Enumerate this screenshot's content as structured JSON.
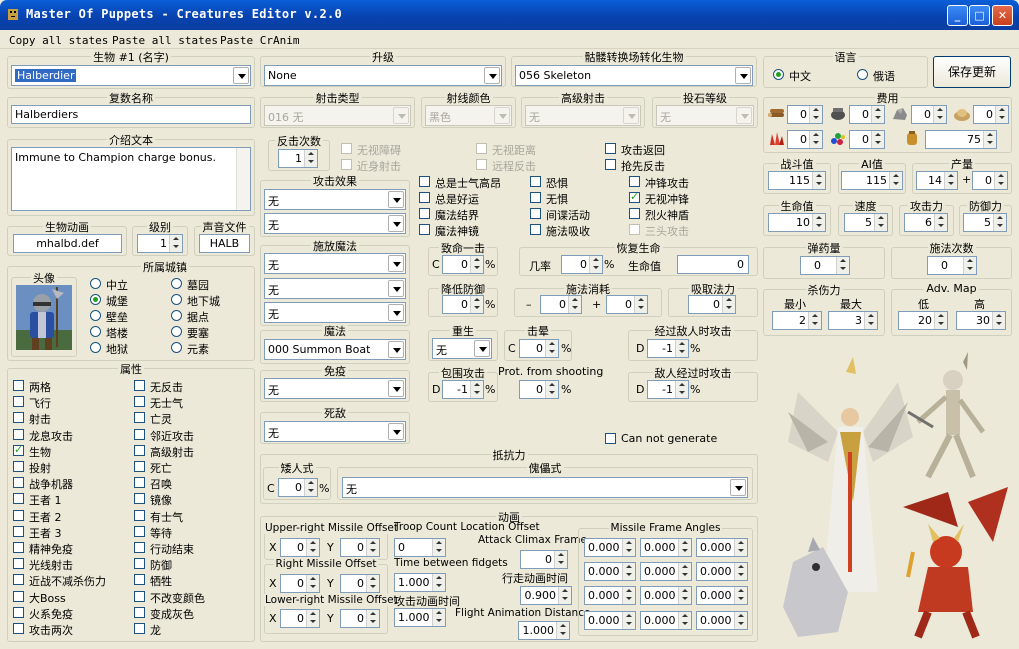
{
  "window": {
    "title": "Master Of Puppets - Creatures Editor v.2.0"
  },
  "menu": [
    "Copy all states",
    "Paste all states",
    "Paste CrAnim"
  ],
  "creature": {
    "name_label": "生物 #1 (名字)",
    "name_value": "Halberdier",
    "plural_label": "复数名称",
    "plural_value": "Halberdiers",
    "desc_label": "介绍文本",
    "desc_value": "Immune to Champion charge bonus.",
    "anim_label": "生物动画",
    "anim_value": "mhalbd.def",
    "level_label": "级别",
    "level_value": "1",
    "sound_label": "声音文件",
    "sound_value": "HALB"
  },
  "portrait": {
    "label": "头像"
  },
  "town": {
    "label": "所属城镇",
    "options": [
      "中立",
      "墓园",
      "城堡",
      "地下城",
      "壁垒",
      "据点",
      "塔楼",
      "要塞",
      "地狱",
      "元素"
    ],
    "selected": "城堡"
  },
  "attributes": {
    "label": "属性",
    "left": [
      {
        "label": "两格",
        "checked": false
      },
      {
        "label": "飞行",
        "checked": false
      },
      {
        "label": "射击",
        "checked": false
      },
      {
        "label": "龙息攻击",
        "checked": false
      },
      {
        "label": "生物",
        "checked": true
      },
      {
        "label": "投射",
        "checked": false
      },
      {
        "label": "战争机器",
        "checked": false
      },
      {
        "label": "王者 1",
        "checked": false
      },
      {
        "label": "王者 2",
        "checked": false
      },
      {
        "label": "王者 3",
        "checked": false
      },
      {
        "label": "精神免疫",
        "checked": false
      },
      {
        "label": "光线射击",
        "checked": false
      },
      {
        "label": "近战不减杀伤力",
        "checked": false
      },
      {
        "label": "大Boss",
        "checked": false
      },
      {
        "label": "火系免疫",
        "checked": false
      },
      {
        "label": "攻击两次",
        "checked": false
      }
    ],
    "right": [
      {
        "label": "无反击",
        "checked": false
      },
      {
        "label": "无士气",
        "checked": false
      },
      {
        "label": "亡灵",
        "checked": false
      },
      {
        "label": "邻近攻击",
        "checked": false
      },
      {
        "label": "高级射击",
        "checked": false
      },
      {
        "label": "死亡",
        "checked": false
      },
      {
        "label": "召唤",
        "checked": false
      },
      {
        "label": "镜像",
        "checked": false
      },
      {
        "label": "有士气",
        "checked": false
      },
      {
        "label": "等待",
        "checked": false
      },
      {
        "label": "行动结束",
        "checked": false
      },
      {
        "label": "防御",
        "checked": false
      },
      {
        "label": "牺牲",
        "checked": false
      },
      {
        "label": "不改变颜色",
        "checked": false
      },
      {
        "label": "变成灰色",
        "checked": false
      },
      {
        "label": "龙",
        "checked": false
      }
    ]
  },
  "upgrade": {
    "label": "升级",
    "value": "None"
  },
  "skeleton": {
    "label": "骷髅转换场转化生物",
    "value": "056 Skeleton"
  },
  "shoot_type": {
    "label": "射击类型",
    "value": "016 无"
  },
  "ray_color": {
    "label": "射线颜色",
    "value": "黑色"
  },
  "adv_shoot": {
    "label": "高级射击",
    "value": "无"
  },
  "stone_level": {
    "label": "投石等级",
    "value": "无"
  },
  "counter": {
    "label": "反击次数",
    "value": "1"
  },
  "mid_checks": [
    {
      "label": "无视障碍",
      "checked": false,
      "disabled": true
    },
    {
      "label": "近身射击",
      "checked": false,
      "disabled": true
    },
    {
      "label": "无视距离",
      "checked": false,
      "disabled": true
    },
    {
      "label": "远程反击",
      "checked": false,
      "disabled": true
    },
    {
      "label": "攻击返回",
      "checked": false,
      "disabled": false
    },
    {
      "label": "抢先反击",
      "checked": false,
      "disabled": false
    }
  ],
  "attack_effect": {
    "label": "攻击效果",
    "values": [
      "无",
      "无"
    ]
  },
  "effect_checks": [
    {
      "label": "总是士气高昂",
      "checked": false,
      "disabled": false
    },
    {
      "label": "恐惧",
      "checked": false,
      "disabled": false
    },
    {
      "label": "冲锋攻击",
      "checked": false,
      "disabled": false
    },
    {
      "label": "总是好运",
      "checked": false,
      "disabled": false
    },
    {
      "label": "无惧",
      "checked": false,
      "disabled": false
    },
    {
      "label": "无视冲锋",
      "checked": true,
      "disabled": false
    },
    {
      "label": "魔法结界",
      "checked": false,
      "disabled": false
    },
    {
      "label": "间谍活动",
      "checked": false,
      "disabled": false
    },
    {
      "label": "烈火神盾",
      "checked": false,
      "disabled": false
    },
    {
      "label": "魔法神镜",
      "checked": false,
      "disabled": false
    },
    {
      "label": "施法吸收",
      "checked": false,
      "disabled": false
    },
    {
      "label": "三头攻击",
      "checked": false,
      "disabled": true
    }
  ],
  "cast_magic": {
    "label": "施放魔法",
    "values": [
      "无",
      "无",
      "无"
    ]
  },
  "magic": {
    "label": "魔法",
    "value": "000 Summon Boat"
  },
  "immunity": {
    "label": "免疫",
    "value": "无"
  },
  "enemy": {
    "label": "死敌",
    "value": "无"
  },
  "deadly": {
    "label": "致命一击",
    "prefix": "C",
    "value": "0",
    "suffix": "%"
  },
  "revive": {
    "label": "恢复生命",
    "rate_label": "几率",
    "rate_value": "0",
    "rate_suffix": "%",
    "hp_label": "生命值",
    "hp_value": "0"
  },
  "lower_def": {
    "label": "降低防御",
    "value": "0",
    "suffix": "%"
  },
  "spell_cost": {
    "label": "施法消耗",
    "minus": "–",
    "v1": "0",
    "plus": "+",
    "v2": "0"
  },
  "absorb": {
    "label": "吸取法力",
    "value": "0"
  },
  "rebirth": {
    "label": "重生",
    "value": "无"
  },
  "stun": {
    "label": "击晕",
    "prefix": "C",
    "value": "0",
    "suffix": "%"
  },
  "passing_attack": {
    "label": "经过敌人时攻击",
    "prefix": "D",
    "value": "-1",
    "suffix": "%"
  },
  "surround": {
    "label": "包围攻击",
    "prefix": "D",
    "value": "-1",
    "suffix": "%"
  },
  "prot_shoot": {
    "label": "Prot. from shooting",
    "value": "0",
    "suffix": "%"
  },
  "enemy_passing": {
    "label": "敌人经过时攻击",
    "prefix": "D",
    "value": "-1",
    "suffix": "%"
  },
  "cannot_generate": {
    "label": "Can not generate",
    "checked": false
  },
  "resistance": {
    "label": "抵抗力",
    "dwarf_label": "矮人式",
    "dwarf_prefix": "C",
    "dwarf_value": "0",
    "dwarf_suffix": "%",
    "golem_label": "傀儡式",
    "golem_value": "无"
  },
  "language": {
    "label": "语言",
    "options": [
      "中文",
      "俄语"
    ],
    "selected": "中文"
  },
  "save_button": "保存更新",
  "cost": {
    "label": "费用",
    "items": [
      {
        "icon": "wood-icon",
        "value": "0"
      },
      {
        "icon": "mercury-icon",
        "value": "0"
      },
      {
        "icon": "ore-icon",
        "value": "0"
      },
      {
        "icon": "sulfur-icon",
        "value": "0"
      },
      {
        "icon": "crystal-icon",
        "value": "0"
      },
      {
        "icon": "gems-icon",
        "value": "0"
      },
      {
        "icon": "gold-icon",
        "value": "75"
      }
    ]
  },
  "stats": {
    "fight_label": "战斗值",
    "fight_value": "115",
    "ai_label": "AI值",
    "ai_value": "115",
    "growth_label": "产量",
    "growth_value": "14",
    "growth_plus": "+",
    "growth_bonus": "0",
    "hp_label": "生命值",
    "hp_value": "10",
    "speed_label": "速度",
    "speed_value": "5",
    "attack_label": "攻击力",
    "attack_value": "6",
    "defense_label": "防御力",
    "defense_value": "5",
    "ammo_label": "弹药量",
    "ammo_value": "0",
    "casts_label": "施法次数",
    "casts_value": "0",
    "damage_label": "杀伤力",
    "dmg_min_label": "最小",
    "dmg_min": "2",
    "dmg_max_label": "最大",
    "dmg_max": "3",
    "advmap_label": "Adv. Map",
    "adv_low_label": "低",
    "adv_low": "20",
    "adv_high_label": "高",
    "adv_high": "30"
  },
  "animation": {
    "label": "动画",
    "ur_label": "Upper-right Missile Offset",
    "r_label": "Right Missile Offset",
    "lr_label": "Lower-right Missile Offset",
    "x_label": "X",
    "y_label": "Y",
    "ur_x": "0",
    "ur_y": "0",
    "r_x": "0",
    "r_y": "0",
    "lr_x": "0",
    "lr_y": "0",
    "troop_label": "Troop Count Location Offset",
    "troop_value": "0",
    "climax_label": "Attack Climax Frame",
    "climax_value": "0",
    "fidgets_label": "Time between fidgets",
    "fidgets_value": "1.000",
    "walk_label": "行走动画时间",
    "walk_value": "0.900",
    "attack_time_label": "攻击动画时间",
    "attack_time_value": "1.000",
    "flight_label": "Flight Animation Distance",
    "flight_value": "1.000",
    "angles_label": "Missile Frame Angles",
    "angles": [
      "0.000",
      "0.000",
      "0.000",
      "0.000",
      "0.000",
      "0.000",
      "0.000",
      "0.000",
      "0.000",
      "0.000",
      "0.000",
      "0.000"
    ]
  }
}
